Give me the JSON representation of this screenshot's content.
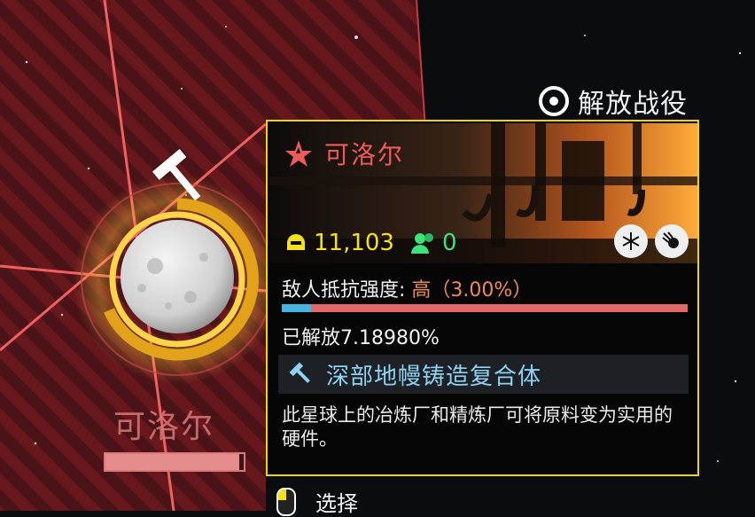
{
  "campaign_label": "解放战役",
  "map_planet": {
    "name": "可洛尔",
    "health_fraction": 0.97
  },
  "planet_card": {
    "name": "可洛尔",
    "players": "11,103",
    "friends": "0",
    "hazards": [
      "snowflake-icon",
      "meteor-icon"
    ],
    "resistance_label": "敌人抵抗强度:",
    "resistance_level": "高（3.00%）",
    "liberation_progress_percent": 7.1898,
    "liberated_text": "已解放7.18980%",
    "sector_name": "深部地幔铸造复合体",
    "description": "此星球上的冶炼厂和精炼厂可将原料变为实用的硬件。"
  },
  "select_hint": "选择",
  "colors": {
    "card_border": "#f0d40a",
    "enemy_red": "#ef5b5b",
    "liberation_blue": "#45b4e0",
    "player_yellow": "#f3e21a",
    "friend_green": "#3ee27d"
  }
}
